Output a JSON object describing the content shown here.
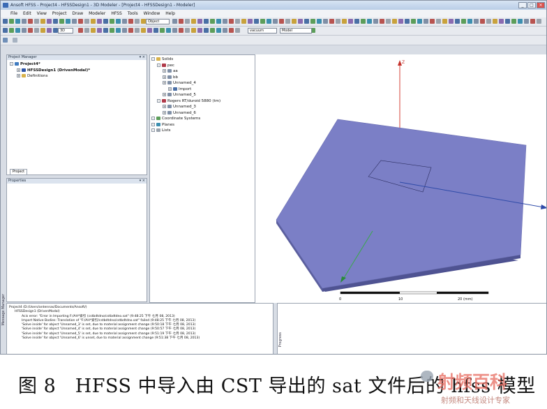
{
  "window": {
    "title": "Ansoft HFSS - Project4 - HFSSDesign1 - 3D Modeler - [Project4 - HFSSDesign1 - Modeler]"
  },
  "menu": [
    "File",
    "Edit",
    "View",
    "Project",
    "Draw",
    "Modeler",
    "HFSS",
    "Tools",
    "Window",
    "Help"
  ],
  "toolbar": {
    "select_mode": "Object",
    "zoom_value": "3D",
    "material_value": "vacuum",
    "model_value": "Model"
  },
  "project_manager": {
    "header": "Project Manager",
    "tab": "Project",
    "tree": [
      "Project4*",
      "HFSSDesign1 (DrivenModal)*",
      "Definitions"
    ]
  },
  "properties": {
    "header": "Properties"
  },
  "model_tree": [
    {
      "label": "Solids",
      "level": 0,
      "icon": "folder-icon"
    },
    {
      "label": "pec",
      "level": 1,
      "icon": "material-icon"
    },
    {
      "label": "aa",
      "level": 2,
      "icon": "object-icon"
    },
    {
      "label": "bb",
      "level": 2,
      "icon": "object-icon"
    },
    {
      "label": "Unnamed_4",
      "level": 2,
      "icon": "object-icon"
    },
    {
      "label": "Import",
      "level": 3,
      "icon": "import-icon"
    },
    {
      "label": "Unnamed_5",
      "level": 2,
      "icon": "object-icon"
    },
    {
      "label": "Rogers RT/duroid 5880 (tm)",
      "level": 1,
      "icon": "material-icon"
    },
    {
      "label": "Unnamed_3",
      "level": 2,
      "icon": "object-icon"
    },
    {
      "label": "Unnamed_6",
      "level": 2,
      "icon": "object-icon"
    },
    {
      "label": "Coordinate Systems",
      "level": 0,
      "icon": "axis-icon"
    },
    {
      "label": "Planes",
      "level": 0,
      "icon": "plane-icon"
    },
    {
      "label": "Lists",
      "level": 0,
      "icon": "list-icon"
    }
  ],
  "viewport": {
    "axis_z": "Z",
    "scale_labels": [
      "0",
      "10",
      "20 (mm)"
    ],
    "substrate_color": "#7b7fc6",
    "substrate_side_color": "#5b5f9e"
  },
  "message_manager": {
    "label": "Message Manager",
    "lines": [
      "Project4 (D:/Users/antennas/Documents/Ansoft/)",
      "HFSSDesign1 (DrivenModal)",
      "Acis error: \"Error in Importing F:/AH*索引 (cstbdtdno/cstbdtdno.sat\"  (9:48:25 下午  七月 08, 2013)",
      "Import Native Bodies: Translation of \"F:/AH*索引/cstbdtdno/cstbdtdno.sat\" failed  (9:48:25 下午  七月 08, 2013)",
      "'Solve inside' for object 'Unnamed_3' is set, due to material assignment change  (9:50:18 下午  七月 08, 2013)",
      "'Solve inside' for object 'Unnamed_4' is set, due to material assignment change  (9:50:57 下午  七月 08, 2013)",
      "'Solve inside' for object 'Unnamed_5' is set, due to material assignment change  (9:51:19 下午  七月 08, 2013)",
      "'Solve inside' for object 'Unnamed_6' is unset, due to material assignment change  (9:51:38 下午  七月 08, 2013)"
    ]
  },
  "progress": {
    "label": "Progress"
  },
  "caption": "图 8　HFSS 中导入由 CST 导出的 sat 文件后的 hfss 模型",
  "watermark": {
    "brand": "射频百科",
    "sub": "射频和天线设计专家"
  }
}
